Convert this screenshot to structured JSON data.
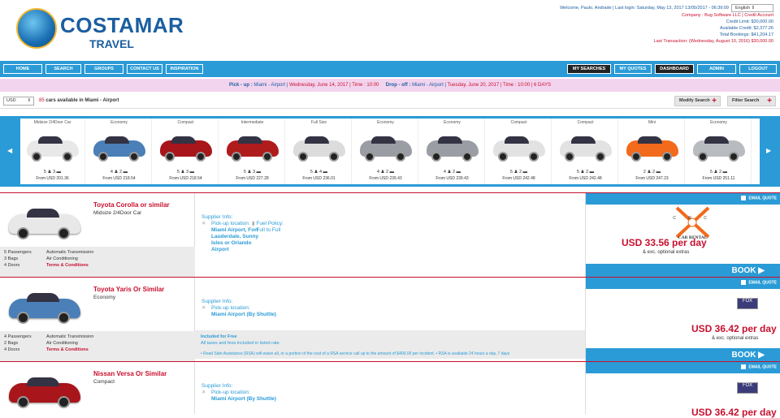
{
  "brand": {
    "name": "COSTAMAR",
    "sub": "TRAVEL"
  },
  "header": {
    "welcome": "Welcome, Paulo. Andrade | Last login: Saturday, May 13, 2017  13/05/2017 - 06:39:09",
    "language": "English",
    "company": "Company : Bug Software LLC | Credit Account",
    "credit_limit": "Credit Limit: $30,000.00",
    "available_credit": "Available Credit: $2,377.26",
    "total_bookings": "Total Bookings: $41,204.17",
    "last_transaction": "Last Transaction: (Wednesday, August 10, 2016) $30,000.00"
  },
  "nav": {
    "home": "HOME",
    "search": "SEARCH",
    "groups": "GROUPS",
    "contact": "CONTACT US",
    "inspiration": "INSPIRATION",
    "my_searches": "MY SEARCHES",
    "my_quotes": "MY QUOTES",
    "dashboard": "DASHBOARD",
    "admin": "ADMIN",
    "logout": "LOGOUT"
  },
  "route": {
    "pickup_label": "Pick - up : ",
    "pickup_loc": "Miami - Airport | ",
    "pickup_date": "Wednesday, June 14, 2017 | Time : 10:00",
    "dropoff_label": "Drop - off : ",
    "dropoff_loc": "Miami - Airport | ",
    "dropoff_date": "Tuesday, June 20, 2017 | Time : 10:00 | 6 DAYS"
  },
  "toolbar": {
    "currency": "USD",
    "count": "85",
    "count_text": " cars available in Miami - Airport",
    "modify": "Modify Search",
    "filter": "Filter Search"
  },
  "carousel": [
    {
      "cat": "Midsize 2/4Door Car",
      "stat": "5 ♟ 3 ▬",
      "price": "From USD 201.36",
      "color": "#e8e8e8"
    },
    {
      "cat": "Economy",
      "stat": "4 ♟ 2 ▬",
      "price": "From USD 218.54",
      "color": "#4a7fb8"
    },
    {
      "cat": "Compact",
      "stat": "5 ♟ 3 ▬",
      "price": "From USD 218.54",
      "color": "#a8151a"
    },
    {
      "cat": "Intermediate",
      "stat": "5 ♟ 3 ▬",
      "price": "From USD 227.28",
      "color": "#b01c1c"
    },
    {
      "cat": "Full Size",
      "stat": "5 ♟ 4 ▬",
      "price": "From USD 236.01",
      "color": "#dcdcdc"
    },
    {
      "cat": "Economy",
      "stat": "4 ♟ 2 ▬",
      "price": "From USD 239.43",
      "color": "#9a9ea4"
    },
    {
      "cat": "Economy",
      "stat": "4 ♟ 2 ▬",
      "price": "From USD 239.43",
      "color": "#9a9ea4"
    },
    {
      "cat": "Compact",
      "stat": "5 ♟ 2 ▬",
      "price": "From USD 242.48",
      "color": "#e2e2e2"
    },
    {
      "cat": "Compact",
      "stat": "5 ♟ 2 ▬",
      "price": "From USD 242.48",
      "color": "#e2e2e2"
    },
    {
      "cat": "Mini",
      "stat": "2 ♟ 2 ▬",
      "price": "From USD 247.23",
      "color": "#f26a1b"
    },
    {
      "cat": "Economy",
      "stat": "5 ♟ 2 ▬",
      "price": "From USD 251.11",
      "color": "#b8bcc0"
    }
  ],
  "results": [
    {
      "name": "Toyota Corolla or similar",
      "type": "Midsize 2/4Door Car",
      "passengers": "5 Passengers",
      "bags": "3 Bags",
      "doors": "4 Doors",
      "trans": "Automatic Transmission",
      "ac": "Air Conditioning",
      "terms": "Terms & Conditions",
      "supplier": "Supplier Info:",
      "pickup_label": "Pick-up location:",
      "pickup": "Miami Airport, Fort Lauderdale, Sunny Isles or Orlando Airport",
      "fuel_label": "Fuel Policy:",
      "fuel": "Full to Full",
      "email": "EMAIL QUOTE",
      "price": "USD 33.56 per day",
      "price_sub": "& exc. optional extras",
      "book": "BOOK ▶",
      "vendor": "CAR RENTAL",
      "vendor_letters": "C R C",
      "color": "#e8e8e8"
    },
    {
      "name": "Toyota Yaris Or Similar",
      "type": "Economy",
      "passengers": "4 Passengers",
      "bags": "2 Bags",
      "doors": "4 Doors",
      "trans": "Automatic Transmission",
      "ac": "Air Conditioning",
      "terms": "Terms & Conditions",
      "supplier": "Supplier Info:",
      "pickup_label": "Pick-up location:",
      "pickup": "Miami Airport (By Shuttle)",
      "included_title": "Included for Free",
      "included_sub": "All taxes and fees included in listed rate.",
      "included_rsa": "• Road Side Assistance (RSA) will waive all, or a portion of the cost of a RSA service call up to the amount of $400.00 per incident. • RSA is available 24 hours a day, 7 days",
      "email": "EMAIL QUOTE",
      "price": "USD 36.42 per day",
      "price_sub": "& exc. optional extras",
      "book": "BOOK ▶",
      "vendor": "FOX",
      "color": "#4a7fb8"
    },
    {
      "name": "Nissan Versa Or Similar",
      "type": "Compact",
      "supplier": "Supplier Info:",
      "pickup_label": "Pick-up location:",
      "pickup": "Miami Airport (By Shuttle)",
      "email": "EMAIL QUOTE",
      "price": "USD 36.42 per day",
      "vendor": "FOX",
      "color": "#a8151a"
    }
  ]
}
